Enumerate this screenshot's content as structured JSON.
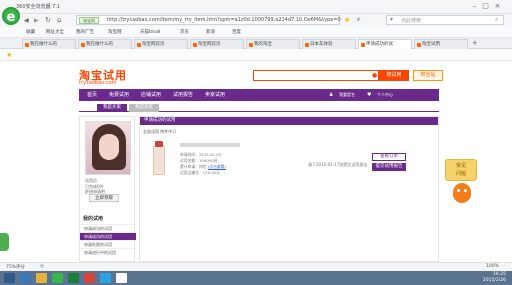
{
  "browser": {
    "window_title": "360安全浏览器 7.1",
    "address_badge": "淘宝网",
    "url": "http://try.taobao.com/item/my_try_item.htm?spm=a1z0d.1000799.a214d7.10.Oe6M&type=0",
    "search_placeholder": "点此搜索",
    "bookmarks": [
      "收藏",
      "网址大全",
      "我的广告",
      "淘宝网",
      "天猫tmall",
      "京东",
      "新浪",
      "百度"
    ],
    "tabs": [
      {
        "label": "我在做什么的"
      },
      {
        "label": "我在做什么的"
      },
      {
        "label": "淘宝网首页"
      },
      {
        "label": "淘宝网首页"
      },
      {
        "label": "我的淘宝"
      },
      {
        "label": "日本车体验"
      },
      {
        "label": "申请成功的试"
      },
      {
        "label": "淘宝试用"
      }
    ]
  },
  "site": {
    "logo_cn": "淘宝试用",
    "logo_en": "try.taobao.com",
    "search_button": "搜试用",
    "all_button": "搜全站",
    "nav": [
      "首页",
      "免费试用",
      "店铺试用",
      "试用报告",
      "卖家试用"
    ],
    "nav_right": [
      "我要提名",
      "个人中心"
    ],
    "subtabs": [
      "我是买家",
      "我是卖家"
    ]
  },
  "sidebar": {
    "role_label": "试用员",
    "desc1": "已完成0件",
    "desc2": "赶快申请吧",
    "get_button": "立即领取",
    "my_trials_title": "我的试用",
    "items": [
      "申请成功的试用",
      "申请成功的试用",
      "申请失败的试用",
      "申请进行中的试用"
    ]
  },
  "content": {
    "header": "申请成功的试用",
    "filters": "全部试用    附件中订",
    "info": [
      "申请时间：2015-02-03",
      "试用名额：100000份",
      "累计申请：待定",
      "试用品编号：120.00元"
    ],
    "link_text": "(点击查看)",
    "status": "请于2015-02-17前提交试用报告",
    "btn_order": "查看订单",
    "btn_report": "提交试用报告"
  },
  "helper": {
    "label_line1": "常见",
    "label_line2": "问题"
  },
  "statusbar": {
    "zoom": "75%",
    "left": "75%评分",
    "right": "100%"
  },
  "taskbar": {
    "time": "16:25",
    "date": "2015/2/26"
  },
  "colors": {
    "brand_orange": "#ff4400",
    "nav_purple": "#6a2a8c",
    "taskbar": "#5a7390"
  }
}
